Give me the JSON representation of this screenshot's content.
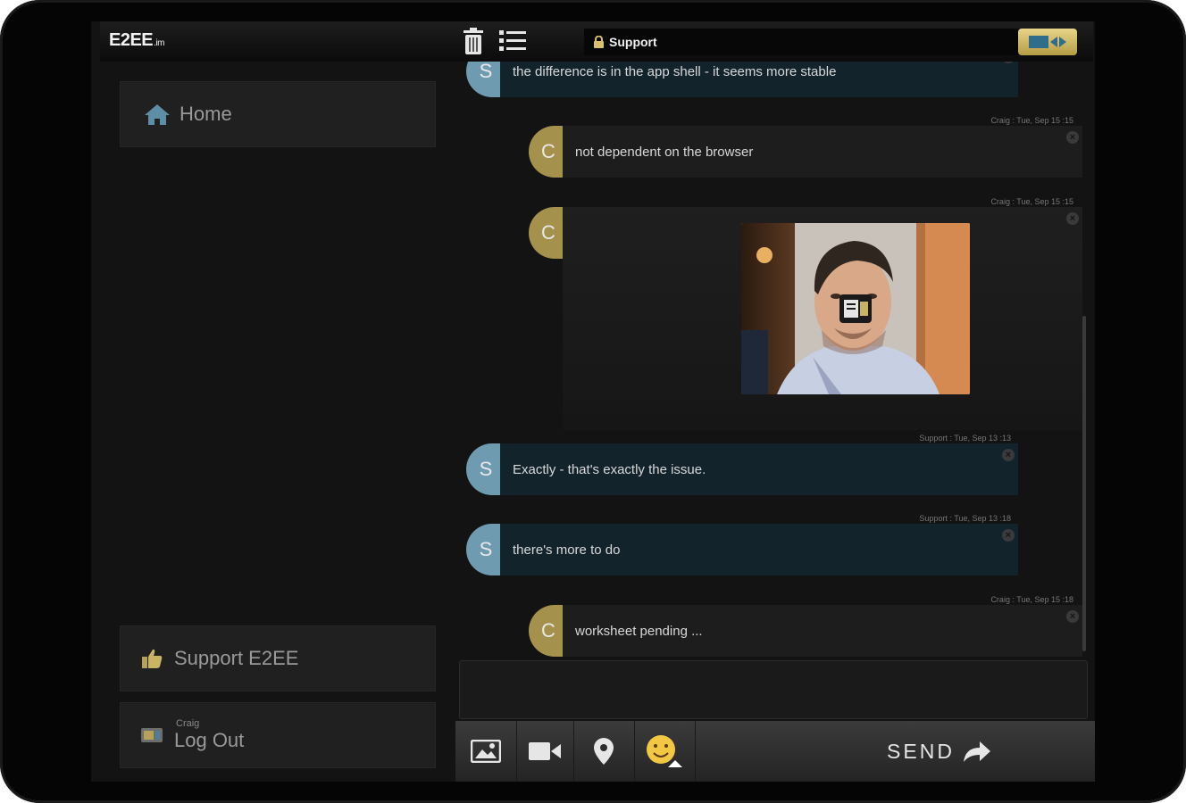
{
  "app": {
    "logo": "E2EE",
    "logo_suffix": ".im"
  },
  "header": {
    "conversation_title": "Support"
  },
  "sidebar": {
    "home_label": "Home",
    "support_label": "Support E2EE",
    "logout_user": "Craig",
    "logout_label": "Log Out"
  },
  "messages": [
    {
      "sender": "support",
      "initial": "S",
      "text": "the difference is in the app shell - it seems more stable",
      "meta": ""
    },
    {
      "sender": "craig",
      "initial": "C",
      "text": "not dependent on the browser",
      "meta": "Craig : Tue, Sep 15 :15"
    },
    {
      "sender": "craig",
      "initial": "C",
      "text": "",
      "meta": "Craig : Tue, Sep 15 :15",
      "type": "video"
    },
    {
      "sender": "support",
      "initial": "S",
      "text": "Exactly - that's exactly the issue.",
      "meta": "Support : Tue, Sep 13 :13"
    },
    {
      "sender": "support",
      "initial": "S",
      "text": "there's more to do",
      "meta": "Support : Tue, Sep 13 :18"
    },
    {
      "sender": "craig",
      "initial": "C",
      "text": "worksheet pending ...",
      "meta": "Craig : Tue, Sep 15 :18"
    }
  ],
  "toolbar": {
    "send_label": "SEND"
  },
  "colors": {
    "support_accent": "#6f9bb0",
    "craig_accent": "#a4924c",
    "gold": "#d8c16e"
  },
  "icons": [
    "trash-icon",
    "list-icon",
    "lock-icon",
    "video-toggle-icon",
    "home-icon",
    "thumbs-up-icon",
    "logout-icon",
    "image-icon",
    "video-camera-icon",
    "location-pin-icon",
    "smiley-icon",
    "send-arrow-icon"
  ]
}
